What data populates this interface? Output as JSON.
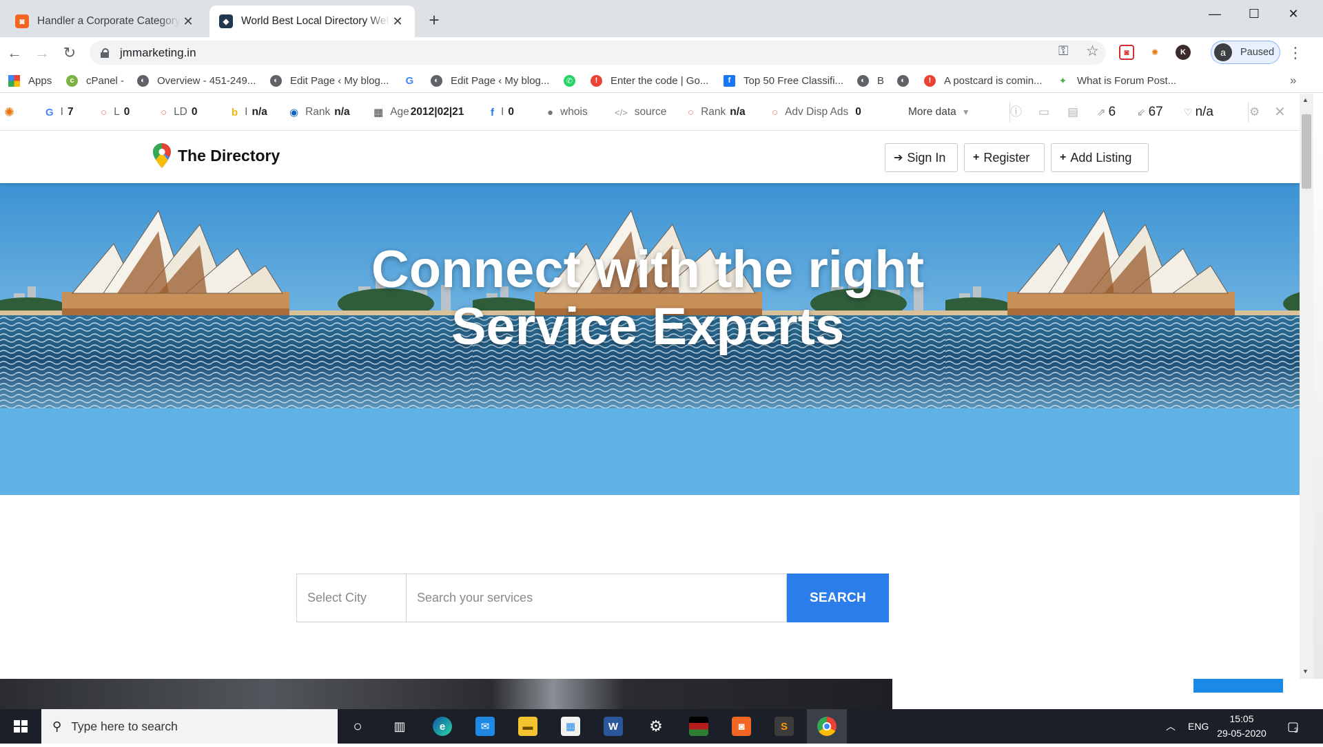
{
  "browser": {
    "tabs": [
      {
        "title": "Handler a Corporate Category Bo",
        "active": false,
        "favicon_color": "#f26522"
      },
      {
        "title": "World Best Local Directory Website",
        "active": true,
        "favicon_color": "#23364f"
      }
    ],
    "address": "jmmarketing.in",
    "profile_initial": "a",
    "profile_status": "Paused",
    "extension_letter": "K",
    "bookmarks": [
      {
        "label": "Apps",
        "icon": "apps-grid-icon"
      },
      {
        "label": "cPanel -",
        "icon": "cpanel-icon"
      },
      {
        "label": "Overview - 451-249...",
        "icon": "globe-icon"
      },
      {
        "label": "Edit Page ‹ My blog...",
        "icon": "globe-icon"
      },
      {
        "label": "",
        "icon": "google-icon"
      },
      {
        "label": "Edit Page ‹ My blog...",
        "icon": "globe-icon"
      },
      {
        "label": "",
        "icon": "whatsapp-icon"
      },
      {
        "label": "Enter the code | Go...",
        "icon": "alert-icon"
      },
      {
        "label": "Top 50 Free Classifi...",
        "icon": "facebook-icon"
      },
      {
        "label": "B",
        "icon": "globe-icon"
      },
      {
        "label": "",
        "icon": "globe-icon"
      },
      {
        "label": "A postcard is comin...",
        "icon": "alert-icon"
      },
      {
        "label": "What is Forum Post...",
        "icon": "forum-icon"
      }
    ],
    "bookmarks_more": "»"
  },
  "seo_bar": {
    "items": [
      {
        "label": "I",
        "value": "7",
        "icon": "google-icon"
      },
      {
        "label": "L",
        "value": "0",
        "icon": "circle-icon"
      },
      {
        "label": "LD",
        "value": "0",
        "icon": "circle-icon"
      },
      {
        "label": "I",
        "value": "n/a",
        "icon": "bing-icon"
      },
      {
        "label": "Rank",
        "value": "n/a",
        "icon": "alexa-icon"
      },
      {
        "label": "Age",
        "value": "2012|02|21",
        "icon": "calendar-icon"
      },
      {
        "label": "I",
        "value": "0",
        "icon": "facebook-icon"
      },
      {
        "label": "whois",
        "value": "",
        "icon": "user-icon"
      },
      {
        "label": "source",
        "value": "",
        "icon": "code-icon"
      },
      {
        "label": "Rank",
        "value": "n/a",
        "icon": "circle-icon"
      },
      {
        "label": "Adv Disp Ads",
        "value": "0",
        "icon": "circle-icon"
      }
    ],
    "more_data": "More data",
    "external_links": "6",
    "internal_links": "67",
    "rank_value": "n/a"
  },
  "site": {
    "logo_text": "The Directory",
    "nav": {
      "sign_in": "Sign In",
      "register": "Register",
      "add_listing": "Add Listing"
    },
    "hero": {
      "line1": "Connect with the right",
      "line2": "Service Experts"
    },
    "search": {
      "city_placeholder": "Select City",
      "service_placeholder": "Search your services",
      "button": "SEARCH"
    }
  },
  "taskbar": {
    "search_placeholder": "Type here to search",
    "language": "ENG",
    "time": "15:05",
    "date": "29-05-2020",
    "notifications": "3"
  },
  "colors": {
    "accent": "#2b7de9",
    "hero_water": "#5fb2e4",
    "taskbar": "#1b1f27"
  }
}
